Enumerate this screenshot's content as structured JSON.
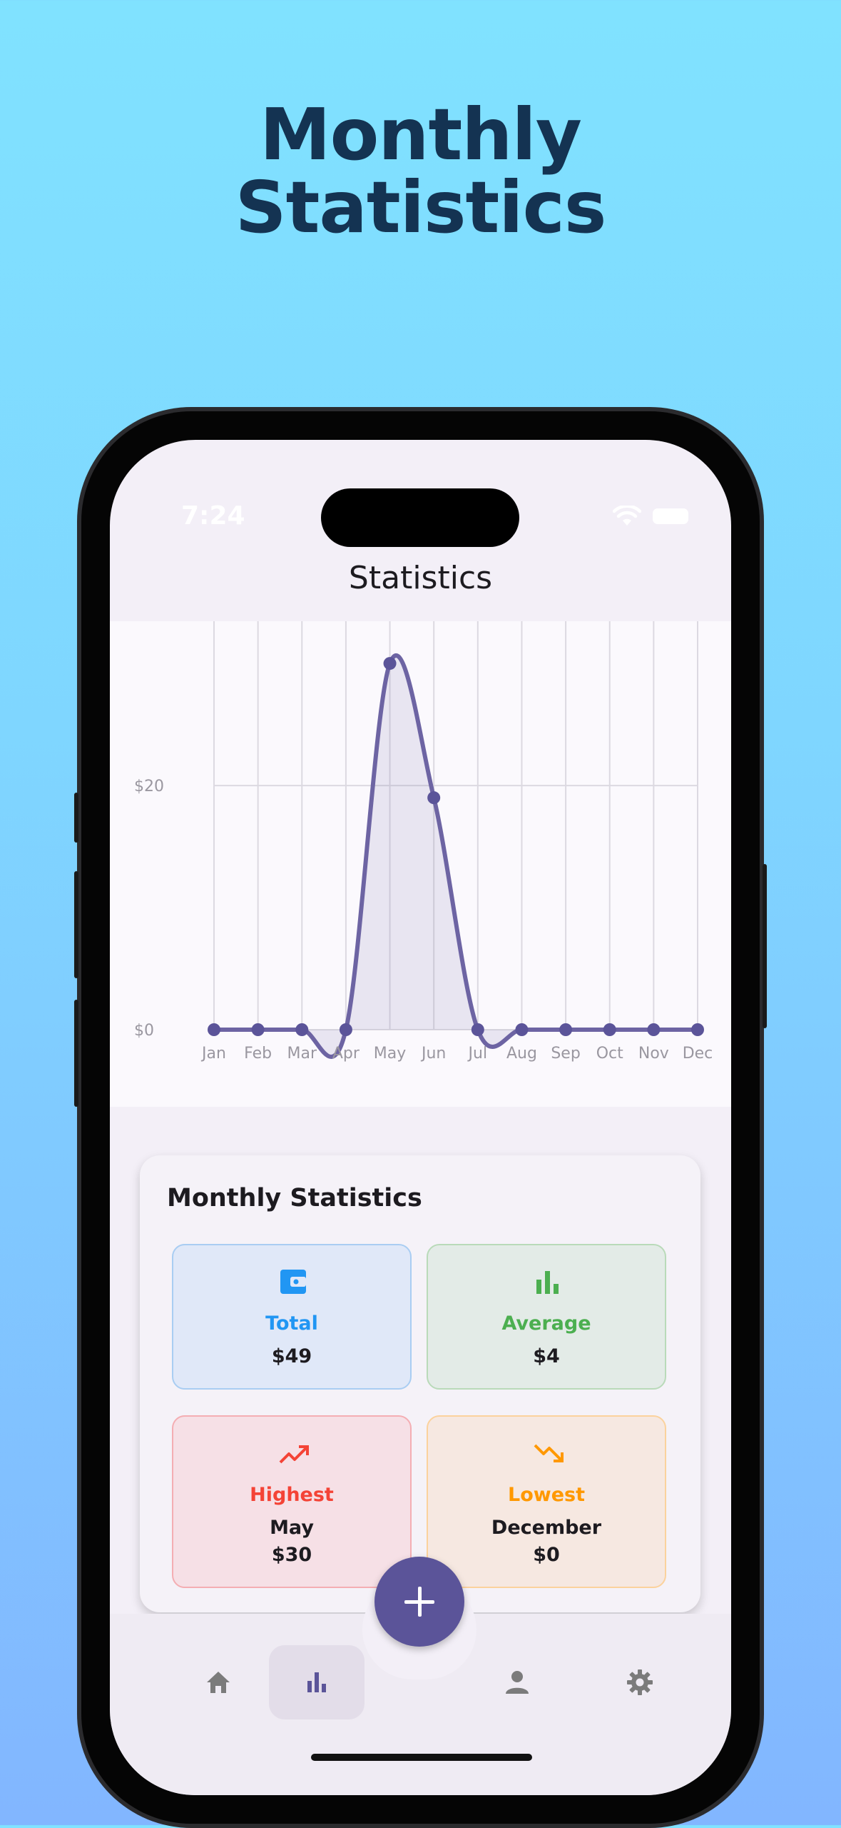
{
  "hero": {
    "line1": "Monthly",
    "line2": "Statistics"
  },
  "status_bar": {
    "time": "7:24"
  },
  "app_bar": {
    "title": "Statistics"
  },
  "chart_data": {
    "type": "line",
    "categories": [
      "Jan",
      "Feb",
      "Mar",
      "Apr",
      "May",
      "Jun",
      "Jul",
      "Aug",
      "Sep",
      "Oct",
      "Nov",
      "Dec"
    ],
    "values": [
      0,
      0,
      0,
      0,
      30,
      19,
      0,
      0,
      0,
      0,
      0,
      0
    ],
    "y_tick_labels": [
      "$0",
      "$20"
    ],
    "y_ticks": [
      0,
      20
    ],
    "ylim": [
      0,
      31
    ],
    "curved": true,
    "filled_area": true,
    "grid": true,
    "line_color": "#6d64a3"
  },
  "stats_card": {
    "heading": "Monthly Statistics",
    "tiles": [
      {
        "label": "Total",
        "value": "$49",
        "icon": "wallet-icon",
        "accent": "#2196f3"
      },
      {
        "label": "Average",
        "value": "$4",
        "icon": "bar-chart-icon",
        "accent": "#4caf50"
      },
      {
        "label": "Highest",
        "value_line1": "May",
        "value_line2": "$30",
        "icon": "trending-up-icon",
        "accent": "#f44336"
      },
      {
        "label": "Lowest",
        "value_line1": "December",
        "value_line2": "$0",
        "icon": "trending-down-icon",
        "accent": "#ff9800"
      }
    ]
  },
  "bottom_nav": {
    "items": [
      "home-icon",
      "stats-icon",
      "profile-icon",
      "settings-icon"
    ],
    "active": "stats-icon"
  },
  "fab": {
    "icon": "plus-icon"
  }
}
